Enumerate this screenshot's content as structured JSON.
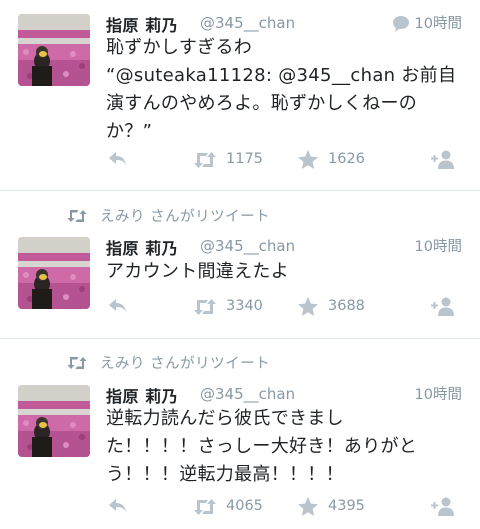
{
  "tweets": [
    {
      "retweet_context": "",
      "name": "指原 莉乃",
      "handle": "@345__chan",
      "time": "10時間",
      "lines": [
        "恥ずかしすぎるわ",
        "“@suteaka11128: @345__chan お前自",
        "演すんのやめろよ。恥ずかしくねーの",
        "か？”"
      ],
      "retweets": "1175",
      "favorites": "1626"
    },
    {
      "retweet_context": "えみり さんがリツイート",
      "name": "指原 莉乃",
      "handle": "@345__chan",
      "time": "10時間",
      "lines": [
        "アカウント間違えたよ"
      ],
      "retweets": "3340",
      "favorites": "3688"
    },
    {
      "retweet_context": "えみり さんがリツイート",
      "name": "指原 莉乃",
      "handle": "@345__chan",
      "time": "10時間",
      "lines": [
        "逆転力読んだら彼氏できまし",
        "た！！！！さっしー大好き！ありがと",
        "う！！！逆転力最高！！！！"
      ],
      "retweets": "4065",
      "favorites": "4395"
    }
  ],
  "icons": {
    "reply": "reply-icon",
    "retweet": "retweet-icon",
    "favorite": "star-icon",
    "follow": "follow-icon",
    "time": "speech-bubble-icon"
  },
  "colors": {
    "muted": "#8899a6",
    "text": "#1f2326",
    "divider": "#e1e8ed"
  }
}
